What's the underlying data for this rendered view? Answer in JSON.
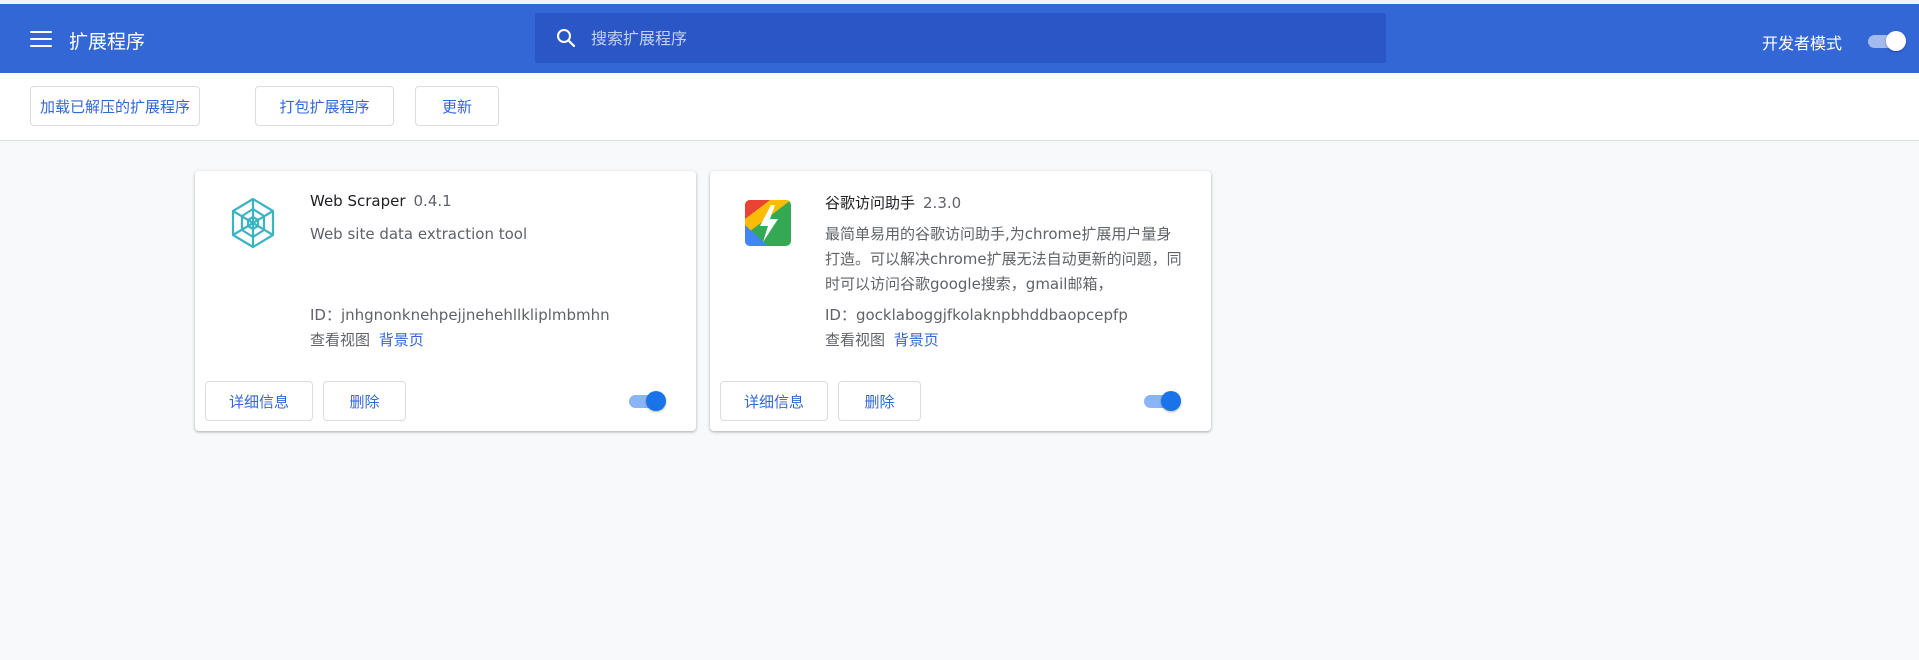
{
  "header": {
    "title": "扩展程序",
    "search_placeholder": "搜索扩展程序",
    "dev_mode_label": "开发者模式",
    "dev_mode_on": true
  },
  "toolbar": {
    "load_unpacked": "加载已解压的扩展程序",
    "pack": "打包扩展程序",
    "update": "更新"
  },
  "extensions": [
    {
      "name": "Web Scraper",
      "version": "0.4.1",
      "description": "Web site data extraction tool",
      "id_label": "ID：",
      "id": "jnhgnonknehpejjnehehllkliplmbmhn",
      "views_label": "查看视图",
      "views_link": "背景页",
      "details_button": "详细信息",
      "remove_button": "删除",
      "enabled": true,
      "icon": "spider-web-icon"
    },
    {
      "name": "谷歌访问助手",
      "version": "2.3.0",
      "description": "最简单易用的谷歌访问助手,为chrome扩展用户量身打造。可以解决chrome扩展无法自动更新的问题，同时可以访问谷歌google搜索，gmail邮箱，",
      "id_label": "ID：",
      "id": "gocklaboggjfkolaknpbhddbaopcepfp",
      "views_label": "查看视图",
      "views_link": "背景页",
      "details_button": "详细信息",
      "remove_button": "删除",
      "enabled": true,
      "icon": "lightning-logo-icon"
    }
  ],
  "colors": {
    "header_bg": "#3367d6",
    "search_bg": "#2a56c6",
    "accent": "#3367d6",
    "toggle_on": "#1a73e8",
    "page_bg": "#f8f9fa"
  }
}
